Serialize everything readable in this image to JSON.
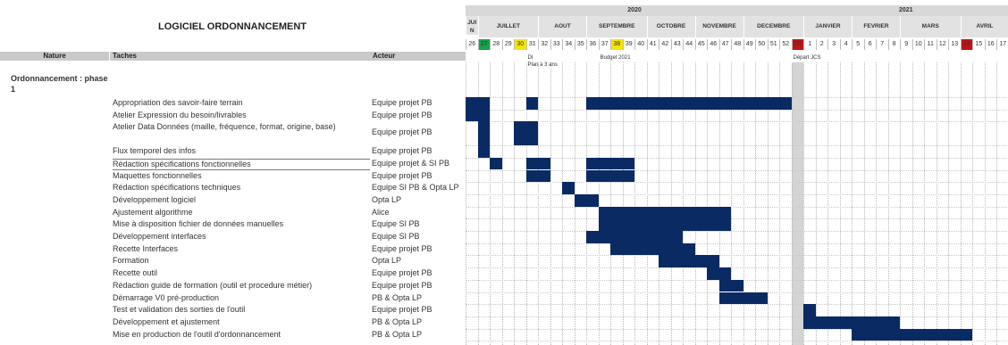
{
  "title": "LOGICIEL ORDONNANCEMENT",
  "columns": {
    "nature": "Nature",
    "taches": "Taches",
    "acteur": "Acteur"
  },
  "nature_label": "Ordonnancement : phase 1",
  "timeline": {
    "years": [
      {
        "label": "2020"
      },
      {
        "label": "2021"
      }
    ],
    "months": [
      "JUI N",
      "JUILLET",
      "AOUT",
      "SEPTEMBRE",
      "OCTOBRE",
      "NOVEMBRE",
      "DECEMBRE",
      "JANVIER",
      "FEVRIER",
      "MARS",
      "AVRIL"
    ],
    "weeks": [
      "26",
      "27",
      "28",
      "29",
      "30",
      "31",
      "32",
      "33",
      "34",
      "35",
      "36",
      "37",
      "38",
      "39",
      "40",
      "41",
      "42",
      "43",
      "44",
      "45",
      "46",
      "47",
      "48",
      "49",
      "50",
      "51",
      "52",
      "53",
      "1",
      "2",
      "3",
      "4",
      "5",
      "6",
      "7",
      "8",
      "9",
      "10",
      "11",
      "12",
      "13",
      "14",
      "15",
      "16",
      "17"
    ],
    "week_colors": {
      "27": "#16a34a",
      "30": "#f5e500",
      "38": "#f5e500",
      "53": "#c21414",
      "14": "#c21414"
    },
    "shaded_week": "53",
    "bar_color": "#0a2a63",
    "notes": [
      {
        "week": "31",
        "text": "DI"
      },
      {
        "week": "31",
        "text": "Plan à 3 ans"
      },
      {
        "week": "37",
        "text": "Budget  2021"
      },
      {
        "week": "53",
        "text": "Départ  JCS"
      }
    ]
  },
  "tasks": [
    {
      "name": "Appropriation des savoir-faire terrain",
      "actor": "Equipe projet PB"
    },
    {
      "name": "Atelier Expression du besoin/livrables",
      "actor": "Equipe projet PB"
    },
    {
      "name": "Atelier Data Données (maille, fréquence, format, origine, base)",
      "actor": "Equipe projet PB"
    },
    {
      "name": "Flux temporel des infos",
      "actor": "Equipe projet PB"
    },
    {
      "name": "Rédaction spécifications fonctionnelles",
      "actor": "Equipe projet & SI PB"
    },
    {
      "name": "Maquettes fonctionnelles",
      "actor": "Equipe projet PB"
    },
    {
      "name": "Rédaction spécifications techniques",
      "actor": "Equipe SI PB & Opta LP"
    },
    {
      "name": "Développement logiciel",
      "actor": "Opta LP"
    },
    {
      "name": "Ajustement algorithme",
      "actor": "Alice"
    },
    {
      "name": "Mise à disposition fichier de données manuelles",
      "actor": "Equipe SI PB"
    },
    {
      "name": "Développement interfaces",
      "actor": "Equipe SI PB"
    },
    {
      "name": "Recette Interfaces",
      "actor": "Equipe projet PB"
    },
    {
      "name": "Formation",
      "actor": "Opta LP"
    },
    {
      "name": "Recette outil",
      "actor": "Equipe projet PB"
    },
    {
      "name": "Rédaction guide de formation (outil et procedure métier)",
      "actor": "Equipe projet PB"
    },
    {
      "name": "Démarrage V0 pré-production",
      "actor": "PB & Opta LP"
    },
    {
      "name": "Test et validation des sorties de l'outil",
      "actor": "Equipe projet PB"
    },
    {
      "name": "Développement et ajustement",
      "actor": "PB & Opta LP"
    },
    {
      "name": "Mise en production de l'outil d'ordonnancement",
      "actor": "PB & Opta LP"
    }
  ],
  "bars": [
    {
      "task": 0,
      "start": "26",
      "end": "27"
    },
    {
      "task": 0,
      "start": "31",
      "end": "31"
    },
    {
      "task": 0,
      "start": "36",
      "end": "52"
    },
    {
      "task": 1,
      "start": "26",
      "end": "27"
    },
    {
      "task": 2,
      "start": "27",
      "end": "27"
    },
    {
      "task": 2,
      "start": "30",
      "end": "31"
    },
    {
      "task": 3,
      "start": "27",
      "end": "27"
    },
    {
      "task": 4,
      "start": "28",
      "end": "28"
    },
    {
      "task": 4,
      "start": "31",
      "end": "32"
    },
    {
      "task": 4,
      "start": "36",
      "end": "39"
    },
    {
      "task": 5,
      "start": "31",
      "end": "32"
    },
    {
      "task": 5,
      "start": "36",
      "end": "39"
    },
    {
      "task": 6,
      "start": "34",
      "end": "34"
    },
    {
      "task": 7,
      "start": "35",
      "end": "36"
    },
    {
      "task": 8,
      "start": "37",
      "end": "47"
    },
    {
      "task": 9,
      "start": "37",
      "end": "47"
    },
    {
      "task": 10,
      "start": "37",
      "end": "43"
    },
    {
      "task": 10,
      "start": "36",
      "end": "36"
    },
    {
      "task": 11,
      "start": "38",
      "end": "44"
    },
    {
      "task": 12,
      "start": "42",
      "end": "46"
    },
    {
      "task": 13,
      "start": "46",
      "end": "47"
    },
    {
      "task": 14,
      "start": "47",
      "end": "48"
    },
    {
      "task": 15,
      "start": "47",
      "end": "50"
    },
    {
      "task": 16,
      "start": "1",
      "end": "1"
    },
    {
      "task": 17,
      "start": "1",
      "end": "4"
    },
    {
      "task": 17,
      "start": "5",
      "end": "8"
    },
    {
      "task": 18,
      "start": "5",
      "end": "13"
    },
    {
      "task": 18,
      "start": "14",
      "end": "14"
    }
  ]
}
